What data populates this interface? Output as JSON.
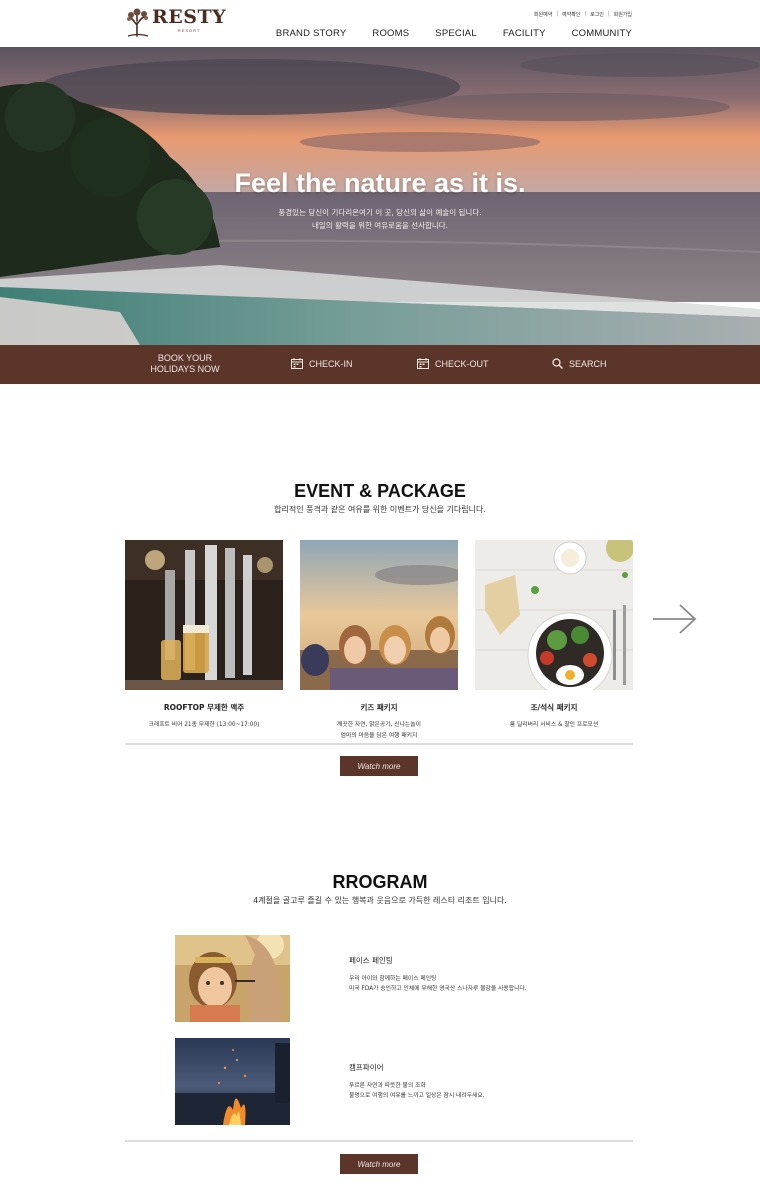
{
  "header": {
    "logo_text": "RESTY",
    "logo_sub": "RESORT",
    "util_links": [
      "회원예약",
      "예약확인",
      "로그인",
      "회원가입"
    ],
    "nav": [
      "BRAND STORY",
      "ROOMS",
      "SPECIAL",
      "FACILITY",
      "COMMUNITY"
    ]
  },
  "hero": {
    "title": "Feel the nature as it is.",
    "subtitle_line1": "풍경있는 당신이 기다리온여기 이 곳, 당신의 삶이 예술이 됩니다.",
    "subtitle_line2": "내일의 활력을 위한 여유로움을 선사합니다."
  },
  "booking": {
    "label_line1": "BOOK YOUR",
    "label_line2": "HOLIDAYS NOW",
    "check_in": "CHECK-IN",
    "check_out": "CHECK-OUT",
    "search": "SEARCH"
  },
  "events": {
    "title": "EVENT & PACKAGE",
    "subtitle": "합리적인 풍격과 같은 여유를 위한 이벤트가 당신을 기다립니다.",
    "cards": [
      {
        "title": "ROOFTOP 무제한 맥주",
        "desc_line1": "크래프트 비어 21종 무제한 (13:00~17:00)",
        "desc_line2": ""
      },
      {
        "title": "키즈 패키지",
        "desc_line1": "깨끗한 자연, 맑은공기, 신나는놀이",
        "desc_line2": "엄마의 마음을 담은 여행 패키지"
      },
      {
        "title": "조/석식 패키지",
        "desc_line1": "룸 딜리버리 서비스 & 할인 프로모션",
        "desc_line2": ""
      }
    ],
    "button": "Watch more"
  },
  "program": {
    "title": "RROGRAM",
    "subtitle": "4계절을 골고루 즐길 수 있는 행복과 웃음으로 가득한 레스티 리조트 입니다.",
    "items": [
      {
        "title": "페이스 페인팅",
        "desc_line1": "우리 아이와 함께하는 페이스 페인팅",
        "desc_line2": "미국 FDA가 승인하고 인체에 무해한 영국산 스나자루 물감을 사용합니다."
      },
      {
        "title": "캠프파이어",
        "desc_line1": "푸르른 자연과 따뜻한 불의 조화",
        "desc_line2": "불멍으로 여행의 여유를 느끼고 일상은 잠시 내려두세요."
      }
    ],
    "button": "Watch more"
  },
  "colors": {
    "brand_brown": "#5b342a",
    "logo_brown": "#4a2c20"
  },
  "icons": [
    "tree-logo-icon",
    "calendar-icon",
    "search-icon",
    "arrow-right-icon"
  ]
}
